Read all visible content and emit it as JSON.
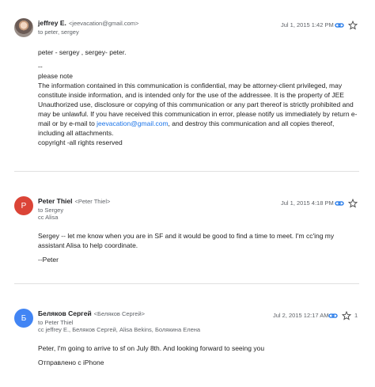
{
  "messages": [
    {
      "sender_name": "jeffrey E.",
      "sender_email": "<jeevacation@gmail.com>",
      "recipients": "to peter, sergey",
      "cc": "",
      "date": "Jul 1, 2015 1:42 PM",
      "avatar_letter": "",
      "avatar_color": "",
      "body": {
        "line1": "peter - sergey , sergey- peter.",
        "sig_dashes": "--",
        "sig_please_note": "please note",
        "disclaimer_1": "The information contained in this communication is confidential, may be attorney-client privileged, may constitute inside information, and is intended only for the use of the addressee. It is the property of JEE Unauthorized use, disclosure or copying of this communication or any part thereof is strictly prohibited and may be unlawful. If you have received this communication in error, please notify us immediately by return e-mail or by e-mail to ",
        "disclaimer_link": "jeevacation@gmail.com",
        "disclaimer_2": ", and destroy this communication and all copies thereof, including all attachments.",
        "copyright": "copyright -all rights reserved"
      }
    },
    {
      "sender_name": "Peter Thiel",
      "sender_email": "<Peter Thiel>",
      "recipients": "to Sergey",
      "cc": "cc Alisa",
      "date": "Jul 1, 2015 4:18 PM",
      "avatar_letter": "P",
      "avatar_color": "#db4437",
      "body": {
        "line1": "Sergey -- let me know when you are in SF and it would be good to find a time to meet. I'm cc'ing my assistant Alisa to help coordinate.",
        "line2": "--Peter"
      }
    },
    {
      "sender_name": "Беляков Сергей",
      "sender_email": "<Беляков Сергей>",
      "recipients": "to Peter Thiel",
      "cc": "cc jeffrey E., Беляков Сергей, Alisa Bekins, Болякина Елена",
      "date": "Jul 2, 2015 12:17 AM",
      "avatar_letter": "Б",
      "avatar_color": "#4285f4",
      "body": {
        "line1": "Peter, I'm going to arrive to sf on July 8th. And looking forward to seeing you",
        "line2": "Отправлено с iPhone"
      }
    }
  ],
  "icons": {
    "link": "link-icon",
    "star": "star-icon",
    "more": "more-icon"
  },
  "more_label": "1",
  "colors": {
    "link": "#1a73e8",
    "icon": "#1a73e8",
    "muted": "#5f6368"
  }
}
